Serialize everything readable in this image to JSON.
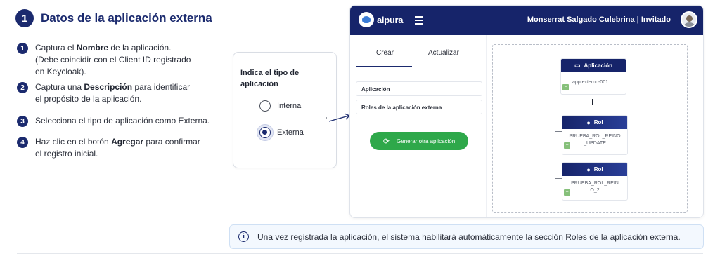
{
  "header": {
    "number": "1",
    "title": "Datos de la aplicación externa"
  },
  "steps": [
    {
      "n": "1",
      "pre": "Captura el ",
      "bold": "Nombre",
      "post": " de la aplicación.",
      "line2": "(Debe coincidir con el Client ID registrado",
      "line3": "en Keycloak)."
    },
    {
      "n": "2",
      "pre": "Captura una ",
      "bold": "Descripción",
      "post": " para identificar",
      "line2": "el propósito de la aplicación."
    },
    {
      "n": "3",
      "text": "Selecciona el tipo de aplicación como Externa."
    },
    {
      "n": "4",
      "pre": "Haz clic en el botón ",
      "bold": "Agregar",
      "post": " para confirmar",
      "line2": "el registro inicial."
    }
  ],
  "type_card": {
    "title": "Indica el tipo de aplicación",
    "options": [
      {
        "label": "Interna",
        "selected": false
      },
      {
        "label": "Externa",
        "selected": true
      }
    ]
  },
  "app": {
    "logo_text": "alpura",
    "user": "Monserrat Salgado Culebrina | Invitado",
    "tabs": [
      {
        "label": "Crear",
        "active": true
      },
      {
        "label": "Actualizar",
        "active": false
      }
    ],
    "fields": [
      "Aplicación",
      "Roles de la aplicación externa"
    ],
    "generate_button": "Generar otra aplicación",
    "diagram": {
      "app_node": {
        "title": "Aplicación",
        "value": "app externo-001"
      },
      "roles": [
        {
          "title": "Rol",
          "value_l1": "PRUEBA_ROL_REINO",
          "value_l2": "_UPDATE",
          "value": "PRUEBA_ROL_REINO_UPDATE"
        },
        {
          "title": "Rol",
          "value_l1": "PRUEBA_ROL_REIN",
          "value_l2": "O_2",
          "value": "PRUEBA_ROL_REINO_2"
        }
      ]
    }
  },
  "info": {
    "text": "Una vez registrada la aplicación, el sistema habilitará automáticamente la sección Roles de la aplicación externa."
  },
  "colors": {
    "primary": "#1b2a6e",
    "topbar": "#16246a",
    "button": "#2ea84a",
    "info_bg": "#f3f8fe"
  }
}
